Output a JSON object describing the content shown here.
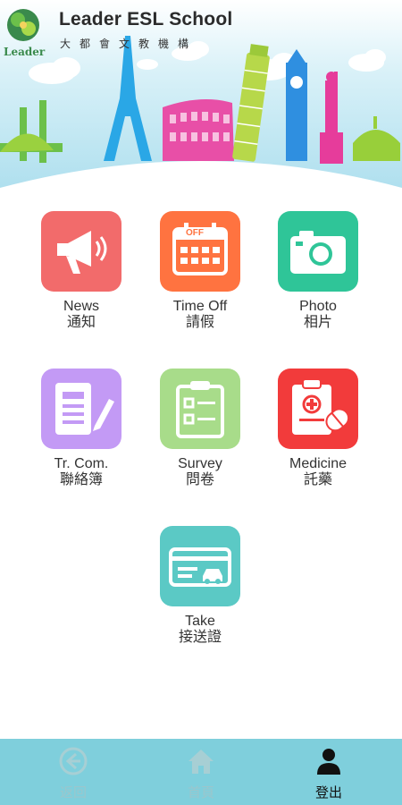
{
  "header": {
    "title": "Leader ESL School",
    "subtitle": "大都會文教機構",
    "logo_text": "Leader"
  },
  "menu": [
    {
      "en": "News",
      "zh": "通知",
      "color": "#f26b6b",
      "icon": "megaphone-icon"
    },
    {
      "en": "Time Off",
      "zh": "請假",
      "color": "#ff7340",
      "icon": "calendar-off-icon",
      "badge": "OFF"
    },
    {
      "en": "Photo",
      "zh": "相片",
      "color": "#2fc598",
      "icon": "camera-icon"
    },
    {
      "en": "Tr. Com.",
      "zh": "聯絡簿",
      "color": "#c39af5",
      "icon": "notebook-pencil-icon"
    },
    {
      "en": "Survey",
      "zh": "問卷",
      "color": "#a8dc8a",
      "icon": "clipboard-checklist-icon"
    },
    {
      "en": "Medicine",
      "zh": "託藥",
      "color": "#f23b3b",
      "icon": "medicine-clipboard-icon"
    },
    {
      "en": "Take",
      "zh": "接送證",
      "color": "#5bc9c5",
      "icon": "pickup-card-icon"
    }
  ],
  "bottom_nav": [
    {
      "label": "返回",
      "icon": "back-arrow-icon",
      "state": "disabled"
    },
    {
      "label": "首頁",
      "icon": "home-icon",
      "state": "disabled"
    },
    {
      "label": "登出",
      "icon": "user-icon",
      "state": "active"
    }
  ],
  "colors": {
    "bottom_bar": "#7fcfdc",
    "sky": "#bfe8f4"
  }
}
